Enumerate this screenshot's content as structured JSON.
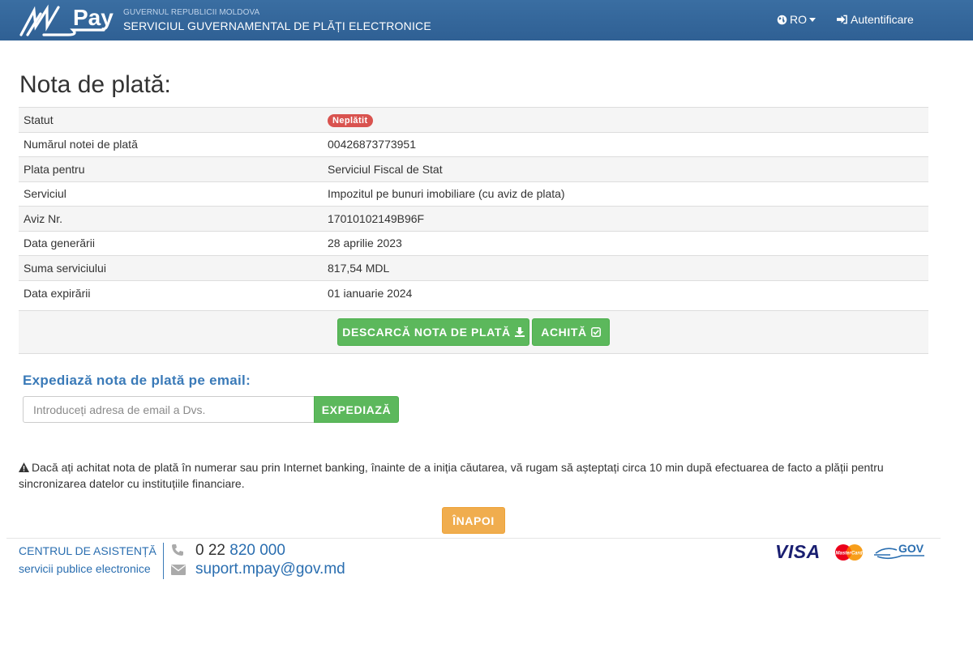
{
  "header": {
    "logo_text": "Pay",
    "gov_line": "GUVERNUL REPUBLICII MOLDOVA",
    "service_line": "SERVICIUL GUVERNAMENTAL DE PLĂȚI ELECTRONICE",
    "language": "RO",
    "login_label": "Autentificare"
  },
  "page_title": "Nota de plată:",
  "details": [
    {
      "label": "Statut",
      "value": "Neplătit",
      "type": "badge"
    },
    {
      "label": "Numărul notei de plată",
      "value": "00426873773951"
    },
    {
      "label": "Plata pentru",
      "value": "Serviciul Fiscal de Stat"
    },
    {
      "label": "Serviciul",
      "value": "Impozitul pe bunuri imobiliare (cu aviz de plata)"
    },
    {
      "label": "Aviz Nr.",
      "value": "17010102149B96F"
    },
    {
      "label": "Data generării",
      "value": "28 aprilie 2023"
    },
    {
      "label": "Suma serviciului",
      "value": "817,54 MDL"
    },
    {
      "label": "Data expirării",
      "value": "01 ianuarie 2024"
    }
  ],
  "actions": {
    "download_label": "DESCARCĂ NOTA DE PLATĂ",
    "pay_label": "ACHITĂ"
  },
  "email": {
    "title": "Expediază nota de plată pe email:",
    "placeholder": "Introduceți adresa de email a Dvs.",
    "value": "",
    "send_label": "EXPEDIAZĂ"
  },
  "notice": "Dacă ați achitat nota de plată în numerar sau prin Internet banking, înainte de a iniția căutarea, vă rugam să așteptați circa 10 min după efectuarea de facto a plății pentru sincronizarea datelor cu instituțiile financiare.",
  "back_label": "ÎNAPOI",
  "footer": {
    "support_title": "CENTRUL DE ASISTENȚĂ",
    "support_subtitle": "servicii publice electronice",
    "phone_prefix": "0 22",
    "phone_number": "820 000",
    "email": "suport.mpay@gov.md",
    "visa": "VISA",
    "mastercard": "MasterCard",
    "mgov": "GOV"
  },
  "colors": {
    "header_bg": "#336699",
    "success": "#5cb85c",
    "warning": "#f0ad4e",
    "danger": "#d9534f",
    "link": "#2a6eb0"
  }
}
